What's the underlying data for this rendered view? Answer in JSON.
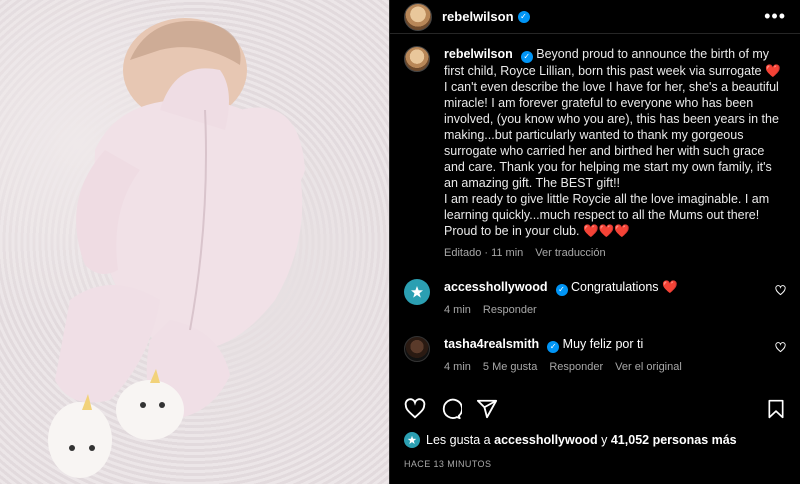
{
  "post": {
    "username": "rebelwilson",
    "caption_p1": "Beyond proud to announce the birth of my first child, Royce Lillian, born this past week via surrogate",
    "caption_heart": "❤️",
    "caption_p2": "I can't even describe the love I have for her, she's a beautiful miracle! I am forever grateful to everyone who has been involved, (you know who you are), this has been years in the making...but particularly wanted to thank my gorgeous surrogate who carried her and birthed her with such grace and care. Thank you for helping me start my own family, it's an amazing gift. The BEST gift!!",
    "caption_p3": "I am ready to give little Roycie all the love imaginable. I am learning quickly...much respect to all the Mums out there! Proud to be in your club.",
    "caption_hearts": "❤️❤️❤️",
    "edited": "Editado · 11 min",
    "translate": "Ver traducción"
  },
  "comments": [
    {
      "username": "accesshollywood",
      "text": "Congratulations",
      "emoji": "❤️",
      "time": "4 min",
      "reply": "Responder"
    },
    {
      "username": "tasha4realsmith",
      "text": "Muy feliz por ti",
      "time": "4 min",
      "likes": "5 Me gusta",
      "reply": "Responder",
      "original": "Ver el original"
    }
  ],
  "likes": {
    "prefix": "Les gusta a",
    "user": "accesshollywood",
    "connector": "y",
    "count": "41,052 personas más"
  },
  "posted": "HACE 13 MINUTOS",
  "colors": {
    "verified": "#0095f6",
    "heart": "#ed4956",
    "background": "#000000"
  },
  "icons": [
    "more-icon",
    "heart-icon",
    "comment-icon",
    "share-icon",
    "save-icon",
    "verified-icon"
  ]
}
